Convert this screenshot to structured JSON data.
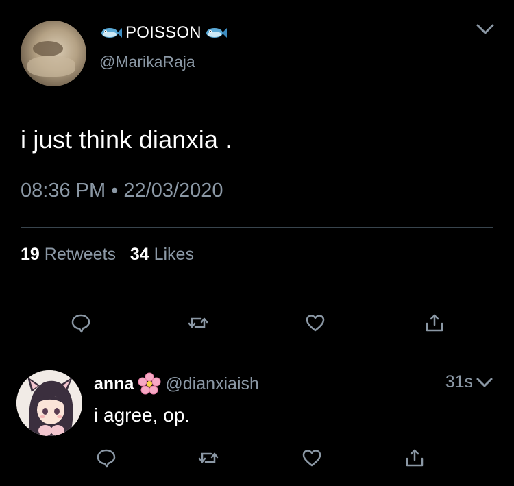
{
  "tweet": {
    "display_name": "POISSON",
    "handle": "@MarikaRaja",
    "text": "i just think dianxia .",
    "timestamp": "08:36 PM • 22/03/2020",
    "retweets_count": "19",
    "retweets_label": "Retweets",
    "likes_count": "34",
    "likes_label": "Likes"
  },
  "reply": {
    "display_name": "anna",
    "handle": "@dianxiaish",
    "time": "31s",
    "text": "i agree, op."
  },
  "icons": {
    "reply": "comment-icon",
    "retweet": "retweet-icon",
    "like": "heart-icon",
    "share": "share-icon",
    "more": "chevron-down-icon",
    "name_emoji": "fish-icon",
    "reply_name_emoji": "cherry-blossom-icon"
  },
  "colors": {
    "background": "#000000",
    "text": "#ffffff",
    "muted": "#8b98a5",
    "divider": "#38444d"
  }
}
